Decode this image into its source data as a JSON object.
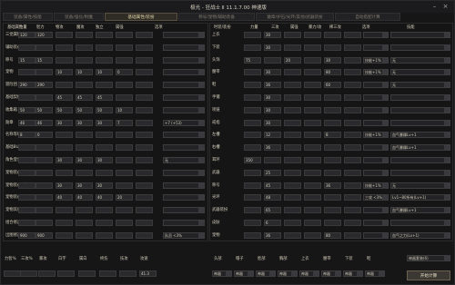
{
  "window": {
    "title": "极光 - 狂战士 Ⅱ 11.1.7.00 神速版"
  },
  "tabs": [
    "装备/属性/技能",
    "装备/强化/附魔",
    "基础属性/装扮",
    "称号/宠物/辅助装备",
    "徽章/护石/光环/其他/武器装扮",
    "自动搭配计算"
  ],
  "left_headers": [
    "基础属性",
    "力量",
    "智力",
    "物攻",
    "魔攻",
    "独立",
    "属强",
    "选项"
  ],
  "left_rows": [
    {
      "label": "三觉属性",
      "vals": [
        "120",
        "120",
        "",
        "",
        "",
        "",
        ""
      ],
      "opt": ""
    },
    {
      "label": "辅助装备BUFF",
      "vals": [
        "",
        "",
        "",
        "",
        "",
        "",
        ""
      ],
      "opt": ""
    },
    {
      "label": "称号",
      "vals": [
        "15",
        "15",
        "",
        "",
        "",
        "",
        ""
      ],
      "opt": ""
    },
    {
      "label": "宠物",
      "vals": [
        "",
        "",
        "10",
        "10",
        "10",
        "0",
        ""
      ],
      "opt": ""
    },
    {
      "label": "冒险团",
      "vals": [
        "290",
        "290",
        "",
        "",
        "",
        "",
        ""
      ],
      "opt": ""
    },
    {
      "label": "基础契约",
      "vals": [
        "",
        "",
        "45",
        "45",
        "45",
        "",
        ""
      ],
      "opt": ""
    },
    {
      "label": "收集箱",
      "vals": [
        "50",
        "50",
        "50",
        "50",
        "50",
        "10",
        ""
      ],
      "opt": ""
    },
    {
      "label": "勋章",
      "vals": [
        "46",
        "46",
        "30",
        "30",
        "30",
        "7",
        ""
      ],
      "opt": "+7 (+53)"
    },
    {
      "label": "名称等级卡",
      "vals": [
        "8",
        "0",
        "",
        "",
        "",
        "",
        ""
      ],
      "opt": ""
    },
    {
      "label": "基础BUFF",
      "vals": [
        "",
        "",
        "",
        "",
        "",
        "",
        ""
      ],
      "opt": ""
    },
    {
      "label": "角色登记卡",
      "vals": [
        "",
        "",
        "30",
        "30",
        "30",
        "",
        ""
      ],
      "opt": "无"
    },
    {
      "label": "宠物装备-红",
      "vals": [
        "",
        "",
        "",
        "",
        "",
        "",
        ""
      ],
      "opt": ""
    },
    {
      "label": "宠物装备-蓝",
      "vals": [
        "",
        "",
        "30",
        "30",
        "30",
        "",
        ""
      ],
      "opt": ""
    },
    {
      "label": "宠物装备-绿",
      "vals": [
        "",
        "",
        "40",
        "40",
        "40",
        "20",
        ""
      ],
      "opt": ""
    },
    {
      "label": "宠物其他",
      "vals": [
        "",
        "",
        "",
        "",
        "",
        "",
        ""
      ],
      "opt": ""
    },
    {
      "label": "组合修正",
      "vals": [
        "",
        "",
        "",
        "",
        "",
        "",
        ""
      ],
      "opt": ""
    },
    {
      "label": "出图修正",
      "vals": [
        "900",
        "900",
        "",
        "",
        "",
        "",
        ""
      ],
      "opt": "队员 <3%"
    }
  ],
  "right_headers": [
    "时装/装扮",
    "力量",
    "三攻",
    "属强",
    "暴力/攻",
    "稀三攻",
    "选项",
    "技能"
  ],
  "right_rows": [
    {
      "label": "上衣",
      "vals": [
        "",
        "30",
        "",
        "",
        "",
        ""
      ],
      "opt": "",
      "skill": ""
    },
    {
      "label": "下装",
      "vals": [
        "",
        "30",
        "",
        "",
        "",
        ""
      ],
      "opt": "",
      "skill": ""
    },
    {
      "label": "头饰",
      "vals": [
        "75",
        "",
        "20",
        "",
        "30",
        ""
      ],
      "opt": "技能+1%",
      "skill": "无"
    },
    {
      "label": "腰带",
      "vals": [
        "",
        "30",
        "",
        "",
        "80",
        ""
      ],
      "opt": "技能+1%",
      "skill": "无"
    },
    {
      "label": "鞋",
      "vals": [
        "",
        "36",
        "",
        "",
        "60",
        ""
      ],
      "opt": "",
      "skill": "无"
    },
    {
      "label": "手镯",
      "vals": [
        "",
        "30",
        "",
        "",
        "",
        ""
      ],
      "opt": "",
      "skill": ""
    },
    {
      "label": "项链",
      "vals": [
        "",
        "30",
        "",
        "",
        "",
        ""
      ],
      "opt": "",
      "skill": ""
    },
    {
      "label": "戒指",
      "vals": [
        "",
        "30",
        "",
        "",
        "",
        ""
      ],
      "opt": "",
      "skill": ""
    },
    {
      "label": "左槽",
      "vals": [
        "",
        "12",
        "",
        "",
        "8",
        ""
      ],
      "opt": "技能+1%",
      "skill": "血气暴躁Lv+1"
    },
    {
      "label": "右槽",
      "vals": [
        "",
        "36",
        "",
        "",
        "",
        ""
      ],
      "opt": "",
      "skill": "血气暴躁Lv+1"
    },
    {
      "label": "耳环",
      "vals": [
        "350",
        "",
        "",
        "",
        "",
        ""
      ],
      "opt": "",
      "skill": ""
    },
    {
      "label": "武器",
      "vals": [
        "",
        "25",
        "",
        "",
        "",
        ""
      ],
      "opt": "",
      "skill": ""
    },
    {
      "label": "称号",
      "vals": [
        "",
        "45",
        "",
        "",
        "36",
        ""
      ],
      "opt": "技能+1%",
      "skill": "无"
    },
    {
      "label": "光环",
      "vals": [
        "",
        "48",
        "",
        "",
        "",
        ""
      ],
      "opt": "三攻 <3%",
      "skill": "Lv1~80所有(Lv+1)"
    },
    {
      "label": "武器装扮",
      "vals": [
        "",
        "65",
        "",
        "",
        "",
        ""
      ],
      "opt": "",
      "skill": "血气暴躁Lv+1"
    },
    {
      "label": "皮肤",
      "vals": [
        "",
        "6",
        "",
        "",
        "",
        ""
      ],
      "opt": "",
      "skill": ""
    },
    {
      "label": "宠物",
      "vals": [
        "",
        "36",
        "",
        "",
        "80",
        ""
      ],
      "opt": "",
      "skill": "血气之力(Lv+1)"
    }
  ],
  "bottom_left_labels": [
    "力智%",
    "三攻%",
    "暴攻",
    "白字",
    "属白",
    "终伤",
    "技攻",
    "攻速"
  ],
  "bottom_left_value": "41.3",
  "bottom_right_labels": [
    "头部",
    "帽子",
    "脸部",
    "胸部",
    "上衣",
    "腰带",
    "下装",
    "鞋"
  ],
  "bottom_right_select_default": "神器",
  "bottom_right_top_select": "神器套装(6)",
  "calc_button": "开始计算"
}
